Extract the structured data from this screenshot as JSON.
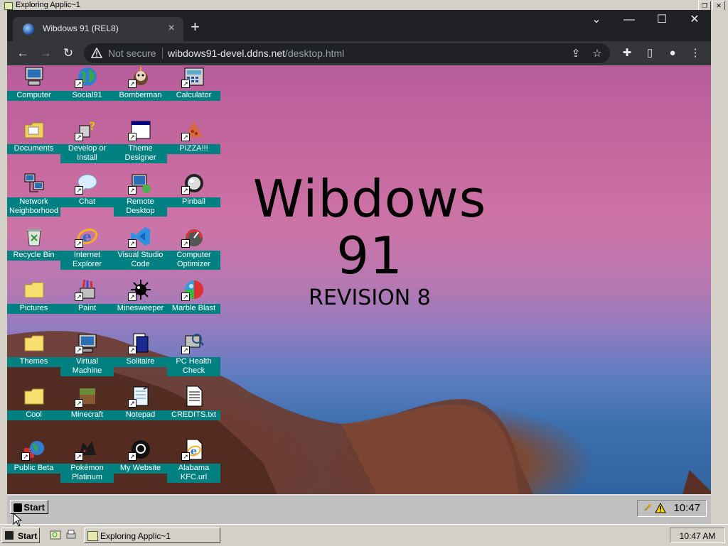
{
  "host_window": {
    "title": "Exploring Applic~1"
  },
  "browser": {
    "tab_title": "Wibdows 91 (REL8)",
    "tab_close": "×",
    "new_tab": "+",
    "window_controls": [
      "⌄",
      "—",
      "☐",
      "✕"
    ],
    "not_secure": "Not secure",
    "url_host": "wibdows91-devel.ddns.net",
    "url_path": "/desktop.html"
  },
  "desktop": {
    "hero_title": "Wibdows 91",
    "hero_subtitle": "REVISION 8",
    "icons": [
      {
        "label": "Computer",
        "icon": "computer-icon"
      },
      {
        "label": "Social91",
        "icon": "globe-icon",
        "shortcut": true
      },
      {
        "label": "Bomberman",
        "icon": "bomberman-icon",
        "shortcut": true
      },
      {
        "label": "Calculator",
        "icon": "calculator-icon",
        "shortcut": true
      },
      {
        "label": "Documents",
        "icon": "folder-documents-icon"
      },
      {
        "label": "Develop or Install",
        "icon": "develop-install-icon",
        "shortcut": true
      },
      {
        "label": "Theme Designer",
        "icon": "window-app-icon",
        "shortcut": true
      },
      {
        "label": "PIZZA!!!",
        "icon": "pizza-icon",
        "shortcut": true
      },
      {
        "label": "Network Neighborhood",
        "icon": "network-icon"
      },
      {
        "label": "Chat",
        "icon": "chat-icon",
        "shortcut": true
      },
      {
        "label": "Remote Desktop",
        "icon": "remote-desktop-icon",
        "shortcut": true
      },
      {
        "label": "Pinball",
        "icon": "pinball-icon",
        "shortcut": true
      },
      {
        "label": "Recycle Bin",
        "icon": "recycle-bin-icon"
      },
      {
        "label": "Internet Explorer",
        "icon": "internet-explorer-icon",
        "shortcut": true
      },
      {
        "label": "Visual Studio Code",
        "icon": "vscode-icon",
        "shortcut": true
      },
      {
        "label": "Computer Optimizer",
        "icon": "optimizer-icon",
        "shortcut": true
      },
      {
        "label": "Pictures",
        "icon": "folder-icon"
      },
      {
        "label": "Paint",
        "icon": "paint-icon",
        "shortcut": true
      },
      {
        "label": "Minesweeper",
        "icon": "minesweeper-icon",
        "shortcut": true
      },
      {
        "label": "Marble Blast",
        "icon": "marble-icon",
        "shortcut": true
      },
      {
        "label": "Themes",
        "icon": "folder-icon"
      },
      {
        "label": "Virtual Machine",
        "icon": "virtual-machine-icon",
        "shortcut": true
      },
      {
        "label": "Solitaire",
        "icon": "solitaire-icon",
        "shortcut": true
      },
      {
        "label": "PC Health Check",
        "icon": "health-check-icon",
        "shortcut": true
      },
      {
        "label": "Cool",
        "icon": "folder-icon"
      },
      {
        "label": "Minecraft",
        "icon": "minecraft-icon",
        "shortcut": true
      },
      {
        "label": "Notepad",
        "icon": "notepad-icon",
        "shortcut": true
      },
      {
        "label": "CREDITS.txt",
        "icon": "text-file-icon"
      },
      {
        "label": "Public Beta",
        "icon": "public-beta-icon",
        "shortcut": true
      },
      {
        "label": "Pokémon Platinum",
        "icon": "pokemon-icon",
        "shortcut": true
      },
      {
        "label": "My Website",
        "icon": "github-icon",
        "shortcut": true
      },
      {
        "label": "Alabama KFC.url",
        "icon": "ie-link-icon",
        "shortcut": true
      }
    ],
    "taskbar": {
      "start_label": "Start",
      "clock": "10:47"
    }
  },
  "host_taskbar": {
    "start_label": "Start",
    "task_label": "Exploring Applic~1",
    "clock": "10:47 AM"
  }
}
